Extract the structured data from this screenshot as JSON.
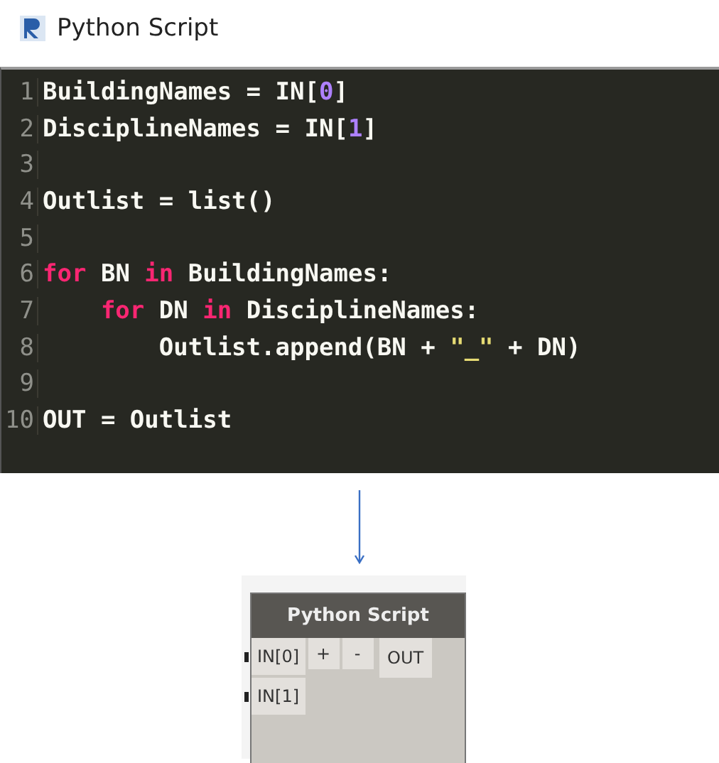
{
  "window": {
    "title": "Python Script"
  },
  "editor": {
    "lines": [
      {
        "number": "1",
        "tokens": [
          {
            "kind": "plain",
            "text": "BuildingNames = IN["
          },
          {
            "kind": "number",
            "text": "0"
          },
          {
            "kind": "plain",
            "text": "]"
          }
        ]
      },
      {
        "number": "2",
        "tokens": [
          {
            "kind": "plain",
            "text": "DisciplineNames = IN["
          },
          {
            "kind": "number",
            "text": "1"
          },
          {
            "kind": "plain",
            "text": "]"
          }
        ]
      },
      {
        "number": "3"
      },
      {
        "number": "4",
        "tokens": [
          {
            "kind": "plain",
            "text": "Outlist = list()"
          }
        ]
      },
      {
        "number": "5"
      },
      {
        "number": "6",
        "tokens": [
          {
            "kind": "keyword",
            "text": "for"
          },
          {
            "kind": "plain",
            "text": " BN "
          },
          {
            "kind": "keyword",
            "text": "in"
          },
          {
            "kind": "plain",
            "text": " BuildingNames:"
          }
        ]
      },
      {
        "number": "7",
        "tokens": [
          {
            "kind": "keyword",
            "text": "    for"
          },
          {
            "kind": "plain",
            "text": " DN "
          },
          {
            "kind": "keyword",
            "text": "in"
          },
          {
            "kind": "plain",
            "text": " DisciplineNames:"
          }
        ]
      },
      {
        "number": "8",
        "tokens": [
          {
            "kind": "plain",
            "text": "        Outlist.append(BN + "
          },
          {
            "kind": "string",
            "text": "\"_\""
          },
          {
            "kind": "plain",
            "text": " + DN)"
          }
        ]
      },
      {
        "number": "9"
      },
      {
        "number": "10",
        "tokens": [
          {
            "kind": "plain",
            "text": "OUT = Outlist"
          }
        ]
      }
    ]
  },
  "node": {
    "title": "Python Script",
    "inputs": [
      "IN[0]",
      "IN[1]"
    ],
    "add_button": "+",
    "remove_button": "-",
    "output": "OUT"
  }
}
